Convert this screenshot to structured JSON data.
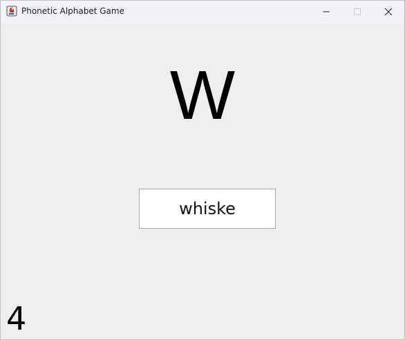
{
  "window": {
    "title": "Phonetic Alphabet Game",
    "app_icon": "java-cup-icon",
    "controls": {
      "minimize_icon": "minimize-icon",
      "maximize_icon": "maximize-icon",
      "close_icon": "close-icon"
    }
  },
  "game": {
    "letter": "W",
    "answer_value": "whiske",
    "score": "4"
  },
  "colors": {
    "background": "#eeeeee",
    "titlebar": "#f3f2f7",
    "text": "#000000",
    "field_bg": "#ffffff",
    "field_border": "#a8a8a8"
  }
}
